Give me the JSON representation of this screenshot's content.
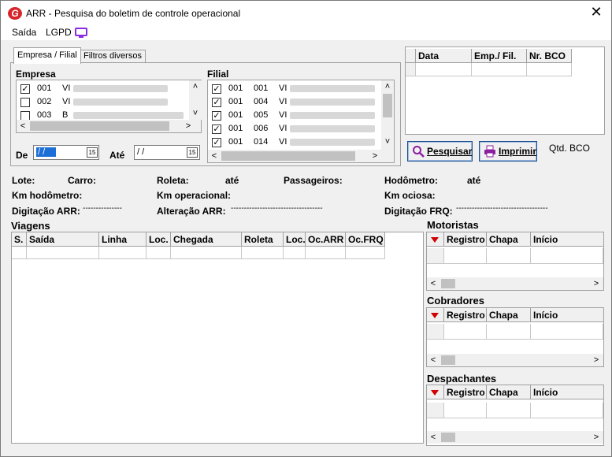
{
  "window": {
    "title": "ARR - Pesquisa do boletim de controle operacional",
    "logo_letter": "G",
    "close_glyph": "✕"
  },
  "menu": {
    "items": [
      "Saída",
      "LGPD"
    ],
    "icon": "monitor-icon"
  },
  "tabs": [
    "Empresa / Filial",
    "Filtros diversos"
  ],
  "empresa": {
    "label": "Empresa",
    "rows": [
      {
        "checked": true,
        "code": "001",
        "name": "VI"
      },
      {
        "checked": false,
        "code": "002",
        "name": "VI"
      },
      {
        "checked": false,
        "code": "003",
        "name": "B"
      }
    ]
  },
  "filial": {
    "label": "Filial",
    "rows": [
      {
        "checked": true,
        "emp": "001",
        "fil": "001",
        "name": "VI"
      },
      {
        "checked": true,
        "emp": "001",
        "fil": "004",
        "name": "VI"
      },
      {
        "checked": true,
        "emp": "001",
        "fil": "005",
        "name": "VI"
      },
      {
        "checked": true,
        "emp": "001",
        "fil": "006",
        "name": "VI"
      },
      {
        "checked": true,
        "emp": "001",
        "fil": "014",
        "name": "VI"
      }
    ]
  },
  "dates": {
    "de_label": "De",
    "ate_label": "Até",
    "de_value": "/ /",
    "ate_value": "/ /",
    "cal_text": "15"
  },
  "top_grid": {
    "headers": [
      "Data",
      "Emp./ Fil.",
      "Nr. BCO"
    ]
  },
  "buttons": {
    "search": "Pesquisar",
    "print": "Imprimir",
    "qtd_label": "Qtd. BCO"
  },
  "fields": {
    "lote": "Lote:",
    "carro": "Carro:",
    "roleta": "Roleta:",
    "ate1": "até",
    "passageiros": "Passageiros:",
    "hodometro": "Hodômetro:",
    "ate2": "até",
    "km_hodometro": "Km hodômetro:",
    "km_operacional": "Km operacional:",
    "km_ociosa": "Km ociosa:",
    "digitacao_arr": "Digitação ARR:",
    "digitacao_arr_value": "---------------",
    "alteracao_arr": "Alteração ARR:",
    "alteracao_arr_value": "-----------------------------------",
    "digitacao_frq": "Digitação FRQ:",
    "digitacao_frq_value": "-----------------------------------"
  },
  "viagens": {
    "title": "Viagens",
    "headers": [
      "S.",
      "Saída",
      "Linha",
      "Loc.",
      "Chegada",
      "Roleta",
      "Loc.",
      "Oc.ARR",
      "Oc.FRQ"
    ]
  },
  "motoristas": {
    "title": "Motoristas",
    "headers": [
      "Registro",
      "Chapa",
      "Início"
    ]
  },
  "cobradores": {
    "title": "Cobradores",
    "headers": [
      "Registro",
      "Chapa",
      "Início"
    ]
  },
  "despachantes": {
    "title": "Despachantes",
    "headers": [
      "Registro",
      "Chapa",
      "Início"
    ]
  },
  "scroll": {
    "left": "<",
    "right": ">",
    "up": "˄",
    "down": "˅"
  },
  "colors": {
    "accent": "#1e4f8f",
    "logo": "#d6262b",
    "monitor": "#8a2be2",
    "sort_arrow": "#d10000"
  }
}
